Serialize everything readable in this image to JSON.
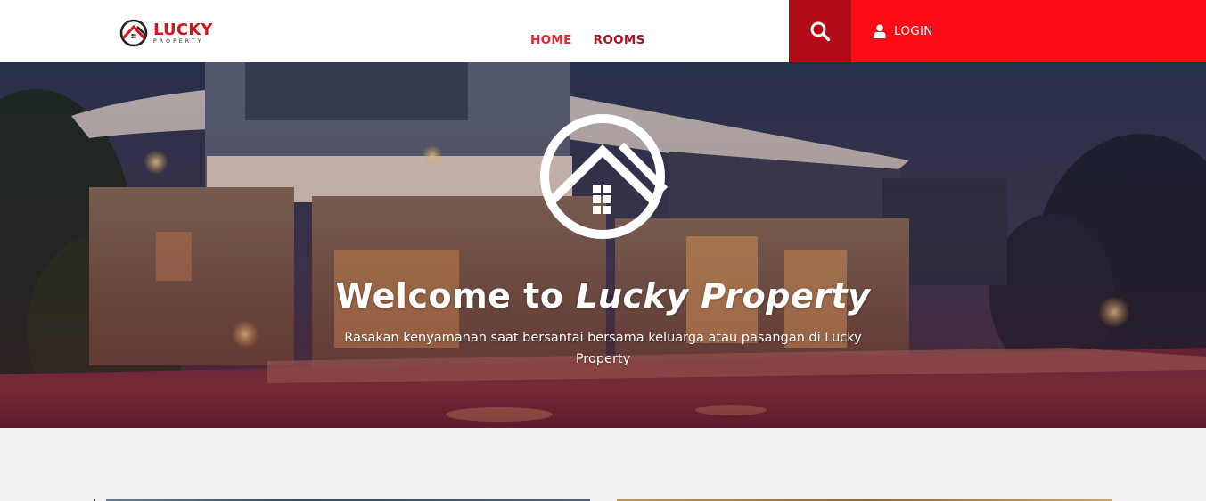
{
  "brand": {
    "name": "LUCKY",
    "tagline": "PROPERTY",
    "colors": {
      "primary": "#ff0a17",
      "dark": "#b00b16",
      "nav_active": "#e8212b",
      "nav": "#b01320"
    }
  },
  "nav": {
    "items": [
      {
        "label": "HOME",
        "active": true
      },
      {
        "label": "ROOMS",
        "active": false
      }
    ]
  },
  "header": {
    "search_icon": "search-icon",
    "login_icon": "user-icon",
    "login_label": "LOGIN"
  },
  "hero": {
    "title_prefix": "Welcome to",
    "title_emphasis": "Lucky Property",
    "subtitle": "Rasakan kenyamanan saat bersantai bersama keluarga atau pasangan di Lucky Property",
    "mark_icon": "house-logo-icon"
  }
}
